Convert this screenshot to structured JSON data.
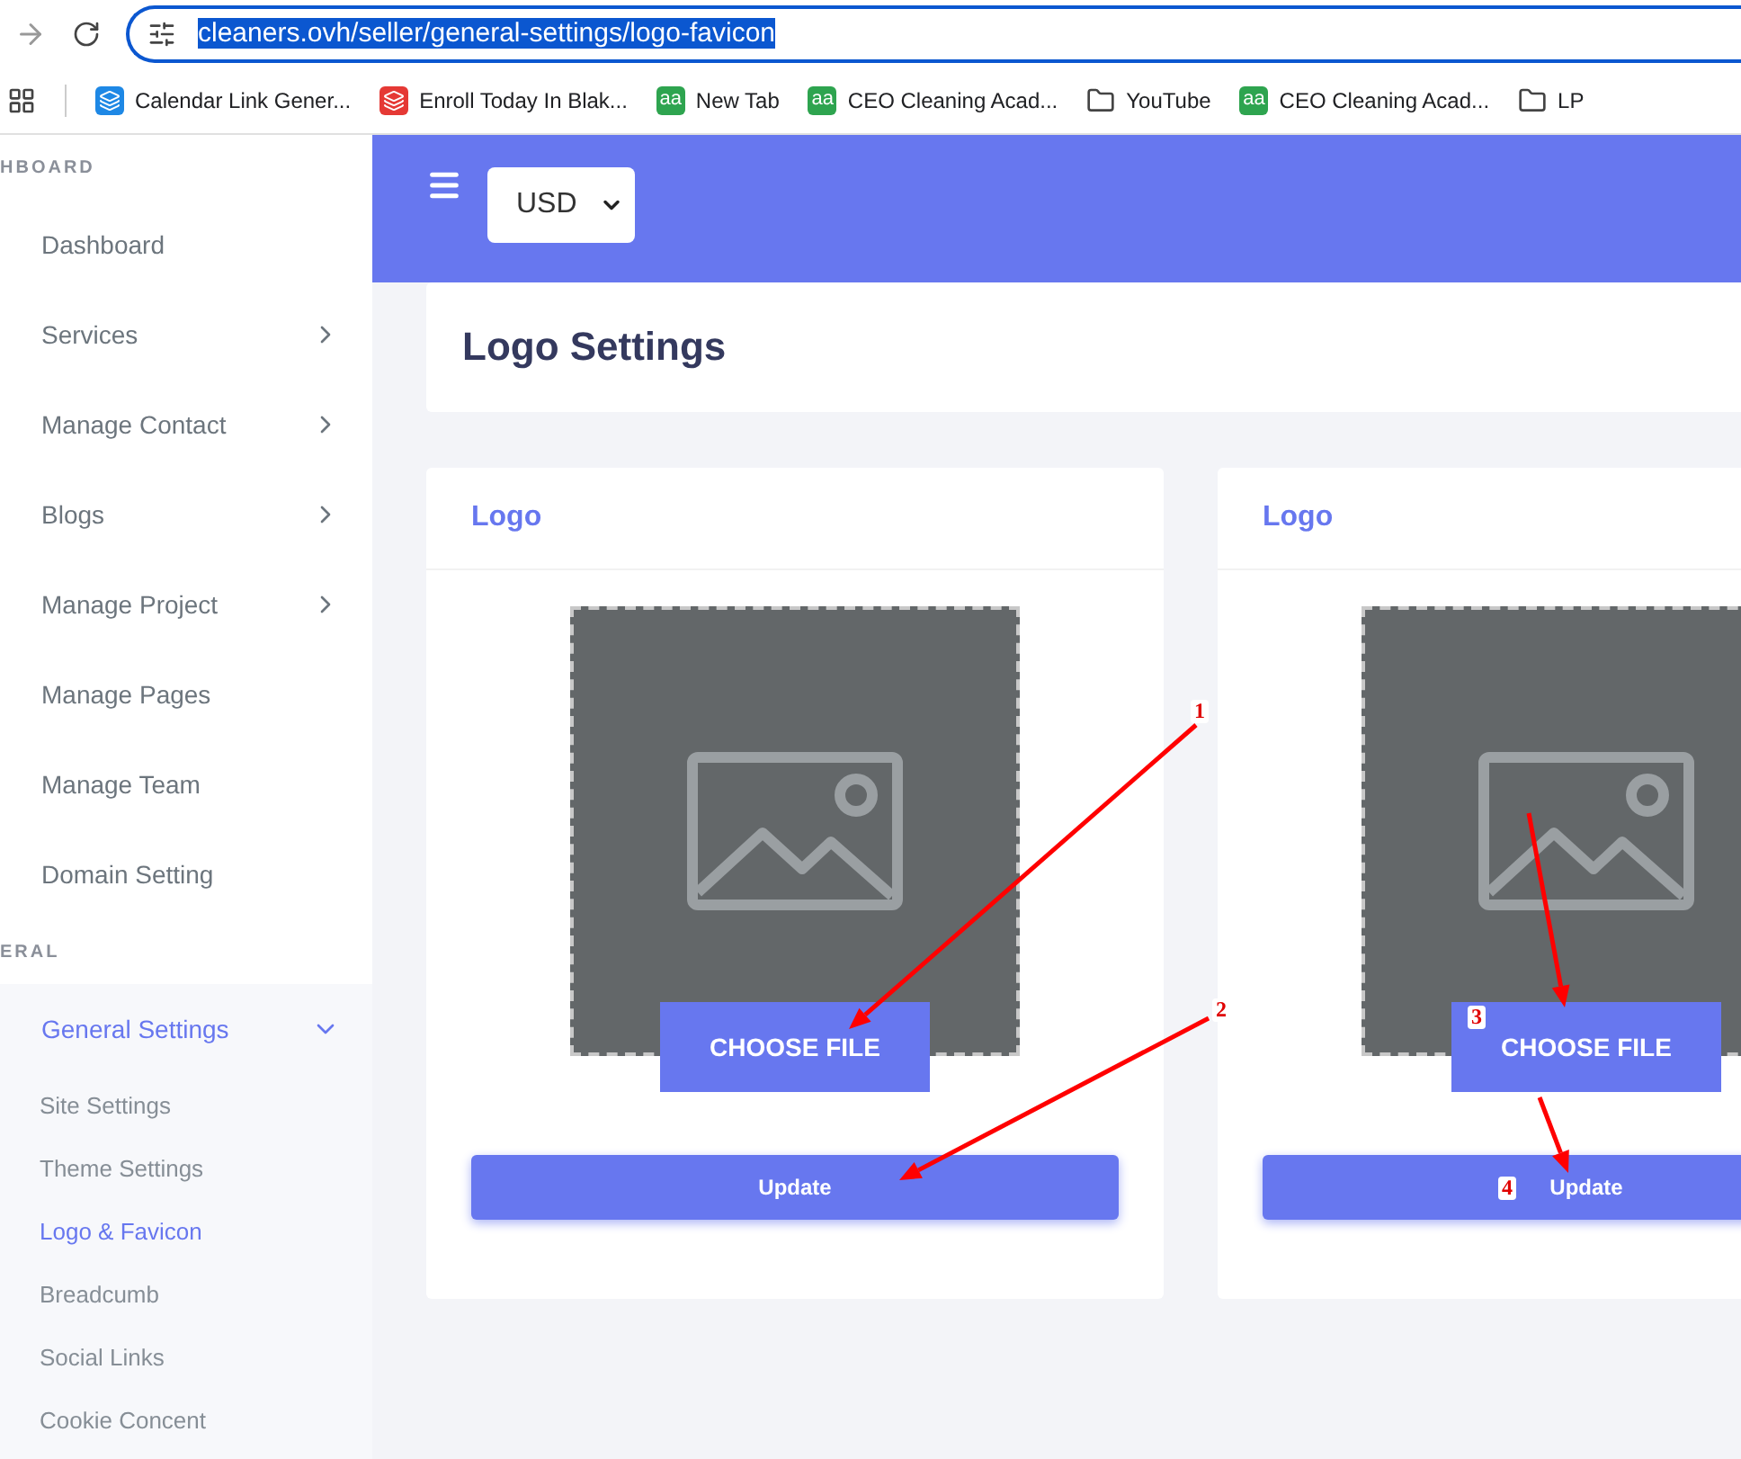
{
  "browser": {
    "url": "cleaners.ovh/seller/general-settings/logo-favicon",
    "url_selected": true
  },
  "bookmarks": [
    {
      "kind": "app",
      "label": "Calendar Link Gener...",
      "color": "#1e88e5"
    },
    {
      "kind": "app",
      "label": "Enroll Today In Blak...",
      "color": "#e53935"
    },
    {
      "kind": "lettered",
      "mark": "aa",
      "label": "New Tab",
      "color": "#2ea44f"
    },
    {
      "kind": "lettered",
      "mark": "aa",
      "label": "CEO Cleaning Acad...",
      "color": "#2ea44f"
    },
    {
      "kind": "folder",
      "label": "YouTube"
    },
    {
      "kind": "lettered",
      "mark": "aa",
      "label": "CEO Cleaning Acad...",
      "color": "#2ea44f"
    },
    {
      "kind": "folder",
      "label": "LP"
    }
  ],
  "sidebar": {
    "sections": [
      {
        "heading": "HBOARD",
        "shaded": false,
        "items": [
          {
            "label": "Dashboard",
            "kind": "link",
            "selected": false
          },
          {
            "label": "Services",
            "kind": "submenu",
            "expanded": false,
            "selected": false
          },
          {
            "label": "Manage Contact",
            "kind": "submenu",
            "expanded": false,
            "selected": false
          },
          {
            "label": "Blogs",
            "kind": "submenu",
            "expanded": false,
            "selected": false
          },
          {
            "label": "Manage Project",
            "kind": "submenu",
            "expanded": false,
            "selected": false
          },
          {
            "label": "Manage Pages",
            "kind": "link",
            "selected": false
          },
          {
            "label": "Manage Team",
            "kind": "link",
            "selected": false
          },
          {
            "label": "Domain Setting",
            "kind": "link",
            "selected": false
          }
        ]
      },
      {
        "heading": "ERAL",
        "shaded": true,
        "items": [
          {
            "label": "General Settings",
            "kind": "submenu",
            "expanded": true,
            "selected": true,
            "children": [
              {
                "label": "Site Settings",
                "selected": false
              },
              {
                "label": "Theme Settings",
                "selected": false
              },
              {
                "label": "Logo & Favicon",
                "selected": true
              },
              {
                "label": "Breadcumb",
                "selected": false
              },
              {
                "label": "Social Links",
                "selected": false
              },
              {
                "label": "Cookie Concent",
                "selected": false
              }
            ]
          }
        ]
      }
    ]
  },
  "header": {
    "currency": "USD"
  },
  "page_title": "Logo Settings",
  "cards": [
    {
      "title": "Logo",
      "choose_button": "CHOOSE FILE",
      "submit_button": "Update"
    },
    {
      "title": "Logo",
      "choose_button": "CHOOSE FILE",
      "submit_button": "Update"
    }
  ],
  "annotations": [
    {
      "label": "1"
    },
    {
      "label": "2"
    },
    {
      "label": "3"
    },
    {
      "label": "4"
    }
  ]
}
